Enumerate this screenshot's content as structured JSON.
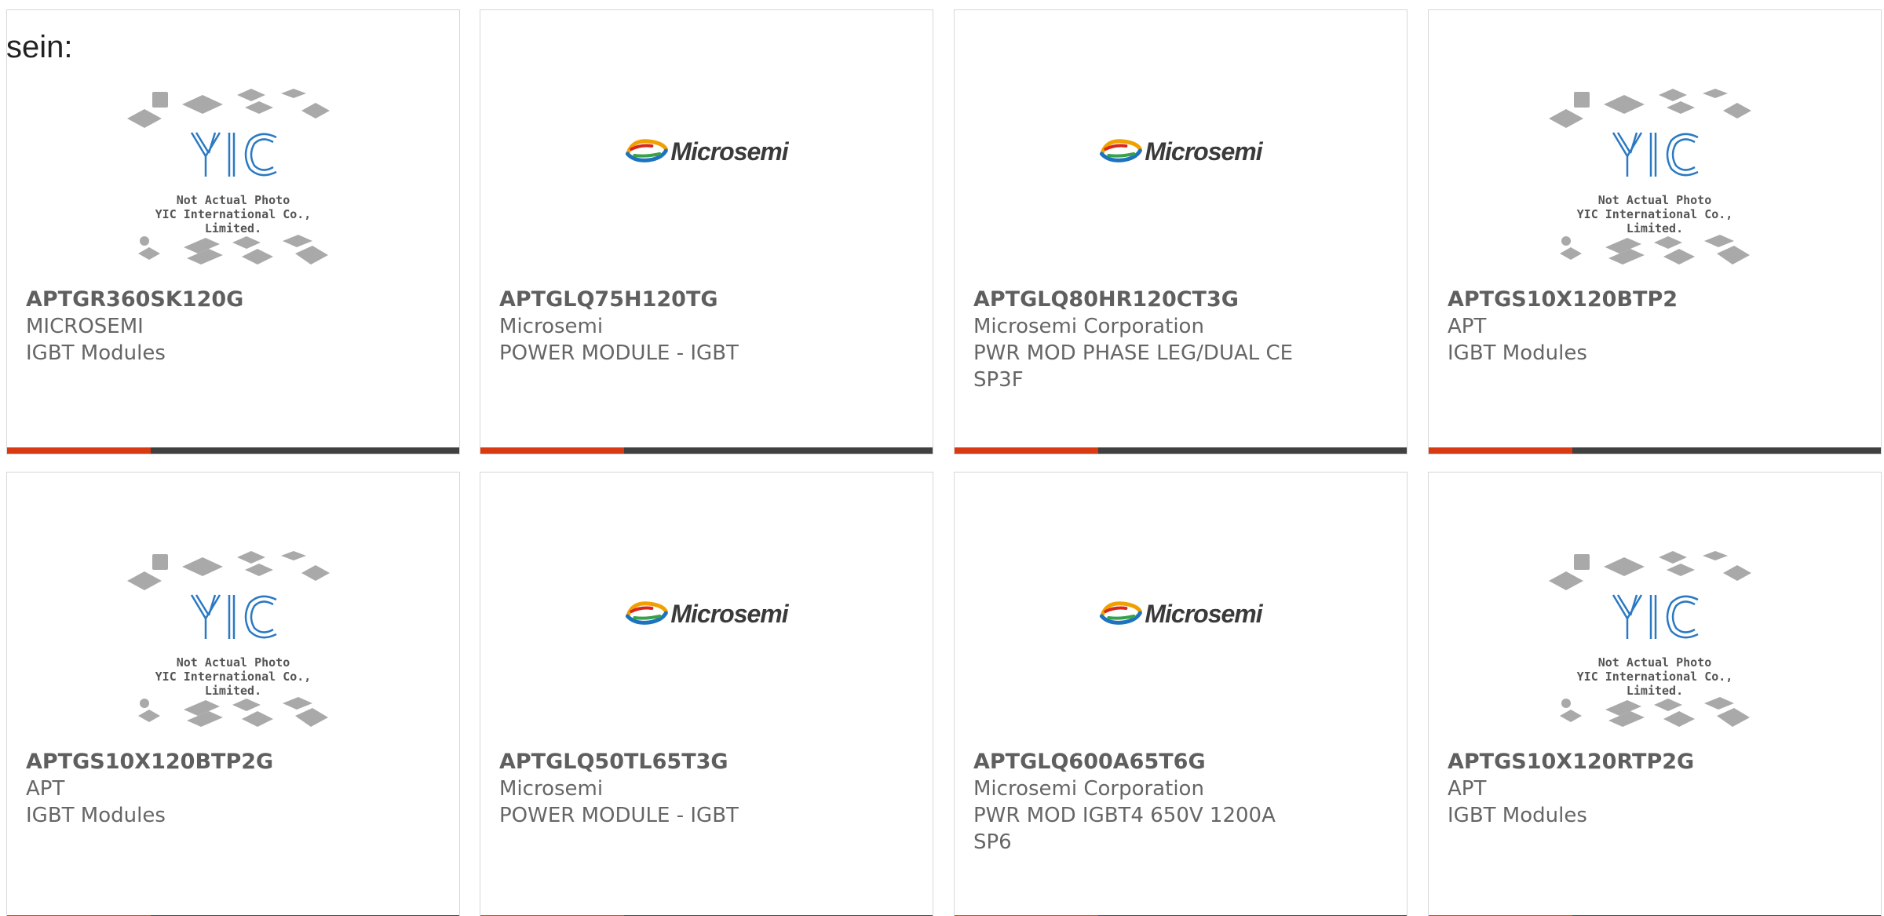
{
  "heading": "sein:",
  "placeholder": {
    "logo_text": "YIC",
    "line1": "Not Actual Photo",
    "line2": "YIC International Co., Limited."
  },
  "brand_logo": {
    "text": "Microsemi"
  },
  "colors": {
    "accent": "#d93a12",
    "bar": "#404040",
    "text": "#666666",
    "border": "#d8d8d8",
    "yic_blue": "#2b79c2"
  },
  "products": [
    {
      "part": "APTGR360SK120G",
      "maker": "MICROSEMI",
      "desc": "IGBT Modules",
      "image": "yic-placeholder"
    },
    {
      "part": "APTGLQ75H120TG",
      "maker": "Microsemi",
      "desc": "POWER MODULE - IGBT",
      "image": "microsemi-logo"
    },
    {
      "part": "APTGLQ80HR120CT3G",
      "maker": "Microsemi Corporation",
      "desc": "PWR MOD PHASE LEG/DUAL CE SP3F",
      "image": "microsemi-logo"
    },
    {
      "part": "APTGS10X120BTP2",
      "maker": "APT",
      "desc": "IGBT Modules",
      "image": "yic-placeholder"
    },
    {
      "part": "APTGS10X120BTP2G",
      "maker": "APT",
      "desc": "IGBT Modules",
      "image": "yic-placeholder"
    },
    {
      "part": "APTGLQ50TL65T3G",
      "maker": "Microsemi",
      "desc": "POWER MODULE - IGBT",
      "image": "microsemi-logo"
    },
    {
      "part": "APTGLQ600A65T6G",
      "maker": "Microsemi Corporation",
      "desc": "PWR MOD IGBT4 650V 1200A SP6",
      "image": "microsemi-logo"
    },
    {
      "part": "APTGS10X120RTP2G",
      "maker": "APT",
      "desc": "IGBT Modules",
      "image": "yic-placeholder"
    }
  ]
}
